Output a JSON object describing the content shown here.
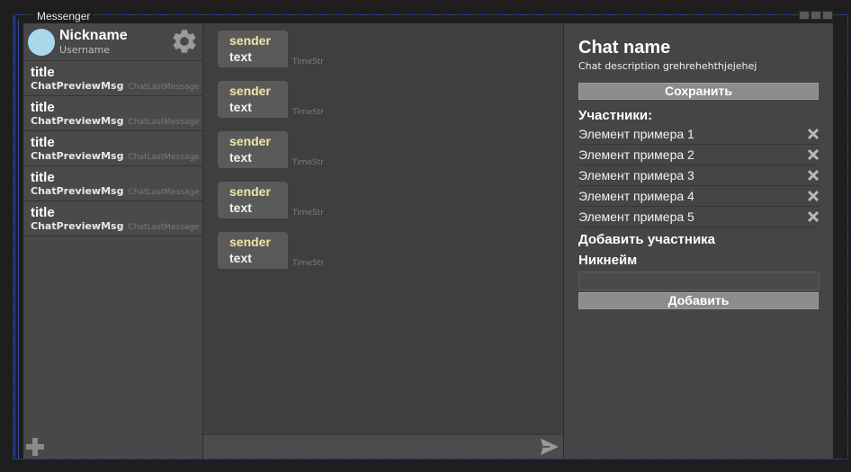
{
  "window": {
    "title": "Messenger"
  },
  "profile": {
    "nickname": "Nickname",
    "username": "Username"
  },
  "chat_list": [
    {
      "title": "title",
      "preview": "ChatPreviewMsg",
      "last": "ChatLastMessage"
    },
    {
      "title": "title",
      "preview": "ChatPreviewMsg",
      "last": "ChatLastMessage"
    },
    {
      "title": "title",
      "preview": "ChatPreviewMsg",
      "last": "ChatLastMessage"
    },
    {
      "title": "title",
      "preview": "ChatPreviewMsg",
      "last": "ChatLastMessage"
    },
    {
      "title": "title",
      "preview": "ChatPreviewMsg",
      "last": "ChatLastMessage"
    }
  ],
  "messages": [
    {
      "sender": "sender",
      "text": "text",
      "time": "TimeStr"
    },
    {
      "sender": "sender",
      "text": "text",
      "time": "TimeStr"
    },
    {
      "sender": "sender",
      "text": "text",
      "time": "TimeStr"
    },
    {
      "sender": "sender",
      "text": "text",
      "time": "TimeStr"
    },
    {
      "sender": "sender",
      "text": "text",
      "time": "TimeStr"
    }
  ],
  "panel": {
    "chat_name": "Chat name",
    "chat_description": "Chat description grehrehehthjejehej",
    "save_label": "Сохранить",
    "members_label": "Участники:",
    "members": [
      "Элемент примера 1",
      "Элемент примера 2",
      "Элемент примера 3",
      "Элемент примера 4",
      "Элемент примера 5"
    ],
    "add_member_label": "Добавить участника",
    "nickname_label": "Никнейм",
    "nickname_value": "",
    "add_label": "Добавить"
  },
  "icons": {
    "settings": "gear-icon",
    "add_chat": "plus-icon",
    "send": "send-icon",
    "remove": "close-icon"
  },
  "colors": {
    "avatar": "#a9d8ea",
    "sender": "#f0e6a8",
    "button": "#8c8c8c"
  }
}
